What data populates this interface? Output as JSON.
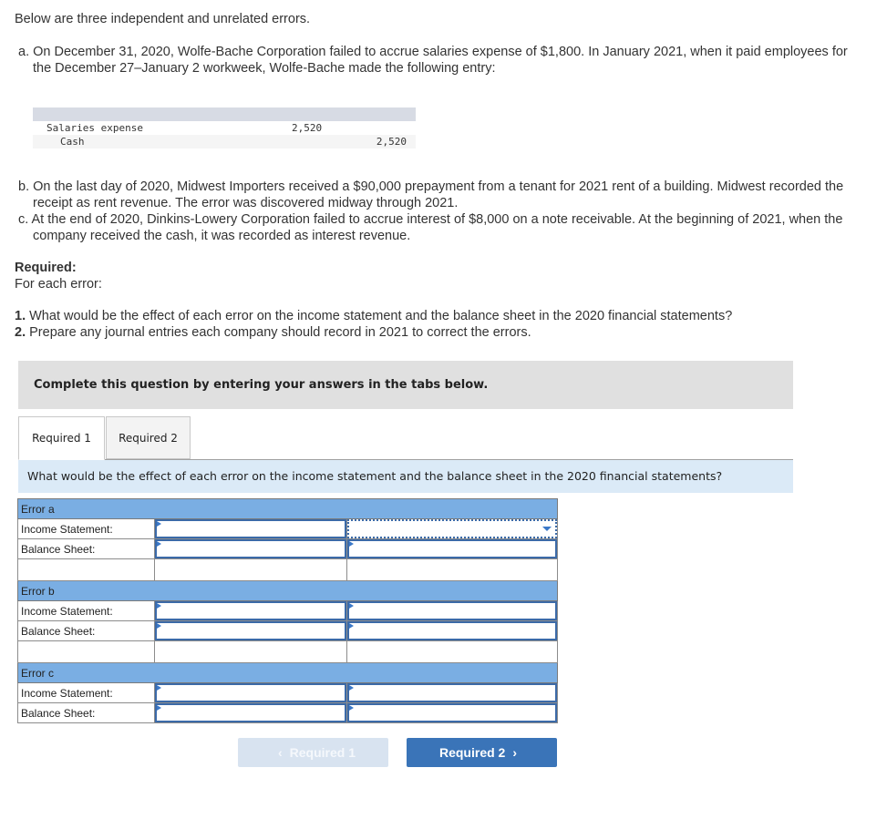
{
  "intro": "Below are three independent and unrelated errors.",
  "errors": {
    "a": {
      "marker": "a.",
      "text": "On December 31, 2020, Wolfe-Bache Corporation failed to accrue salaries expense of $1,800. In January 2021, when it paid employees for the December 27–January 2 workweek, Wolfe-Bache made the following entry:"
    },
    "b": {
      "marker": "b.",
      "text": "On the last day of 2020, Midwest Importers received a $90,000 prepayment from a tenant for 2021 rent of a building. Midwest recorded the receipt as rent revenue. The error was discovered midway through 2021."
    },
    "c": {
      "marker": "c.",
      "text": "At the end of 2020, Dinkins-Lowery Corporation failed to accrue interest of $8,000 on a note receivable. At the beginning of 2021, when the company received the cash, it was recorded as interest revenue."
    }
  },
  "journal": {
    "rows": [
      {
        "account": "Salaries expense",
        "debit": "2,520",
        "credit": ""
      },
      {
        "account": "Cash",
        "debit": "",
        "credit": "2,520"
      }
    ]
  },
  "required": {
    "heading": "Required:",
    "subheading": "For each error:",
    "items": [
      {
        "num": "1.",
        "text": "What would be the effect of each error on the income statement and the balance sheet in the 2020 financial statements?"
      },
      {
        "num": "2.",
        "text": "Prepare any journal entries each company should record in 2021 to correct the errors."
      }
    ]
  },
  "banner": "Complete this question by entering your answers in the tabs below.",
  "tabs": [
    {
      "label": "Required 1",
      "active": true
    },
    {
      "label": "Required 2",
      "active": false
    }
  ],
  "question": "What would be the effect of each error on the income statement and the balance sheet in the 2020 financial statements?",
  "grid": {
    "sections": [
      {
        "title": "Error a",
        "rows": [
          {
            "label": "Income Statement:",
            "v1": "",
            "v2": ""
          },
          {
            "label": "Balance Sheet:",
            "v1": "",
            "v2": ""
          }
        ]
      },
      {
        "title": "Error b",
        "rows": [
          {
            "label": "Income Statement:",
            "v1": "",
            "v2": ""
          },
          {
            "label": "Balance Sheet:",
            "v1": "",
            "v2": ""
          }
        ]
      },
      {
        "title": "Error c",
        "rows": [
          {
            "label": "Income Statement:",
            "v1": "",
            "v2": ""
          },
          {
            "label": "Balance Sheet:",
            "v1": "",
            "v2": ""
          }
        ]
      }
    ]
  },
  "nav": {
    "prev_label": "Required 1",
    "next_label": "Required 2",
    "prev_icon": "chevron-left-icon",
    "next_icon": "chevron-right-icon"
  }
}
